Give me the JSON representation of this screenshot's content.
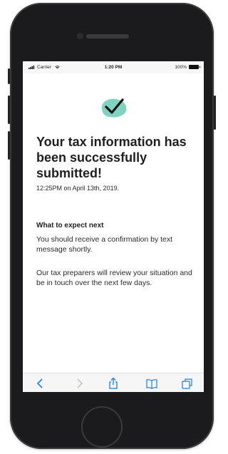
{
  "status_bar": {
    "carrier": "Carrier",
    "time": "1:20 PM",
    "battery": "100%"
  },
  "confirmation": {
    "headline": "Your tax information has been successfully submitted!",
    "timestamp": "12:25PM on April 13th, 2019.",
    "accent_color": "#7fd3c0"
  },
  "next_steps": {
    "title": "What to expect next",
    "paragraph_1": "You should receive a confirmation by text message shortly.",
    "paragraph_2": "Our tax preparers will review your situation and be in touch over the next few days."
  },
  "toolbar": {
    "items": [
      "back-icon",
      "forward-icon",
      "share-icon",
      "bookmarks-icon",
      "tabs-icon"
    ],
    "accent_color": "#1a7cf5"
  }
}
